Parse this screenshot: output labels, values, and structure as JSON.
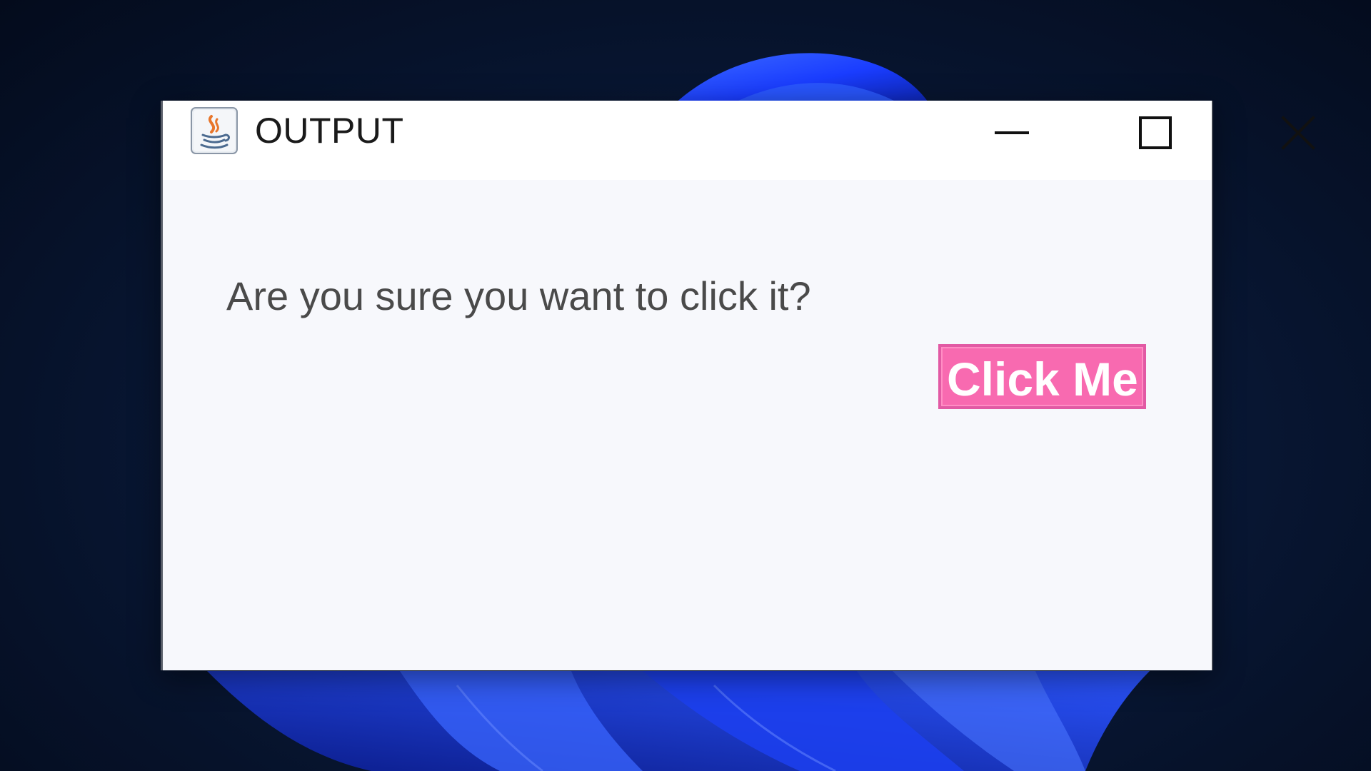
{
  "window": {
    "title": "OUTPUT",
    "app_icon": "java-icon",
    "controls": {
      "minimize_icon": "minimize-icon",
      "maximize_icon": "maximize-icon",
      "close_icon": "close-icon"
    }
  },
  "content": {
    "prompt": "Are you sure you want to click it?",
    "button_label": "Click Me"
  },
  "colors": {
    "button_background": "#f86ab0",
    "button_text": "#ffffff",
    "content_background": "#f7f8fc",
    "desktop_background": "#06122a",
    "wallpaper_accent": "#1e4bff"
  }
}
